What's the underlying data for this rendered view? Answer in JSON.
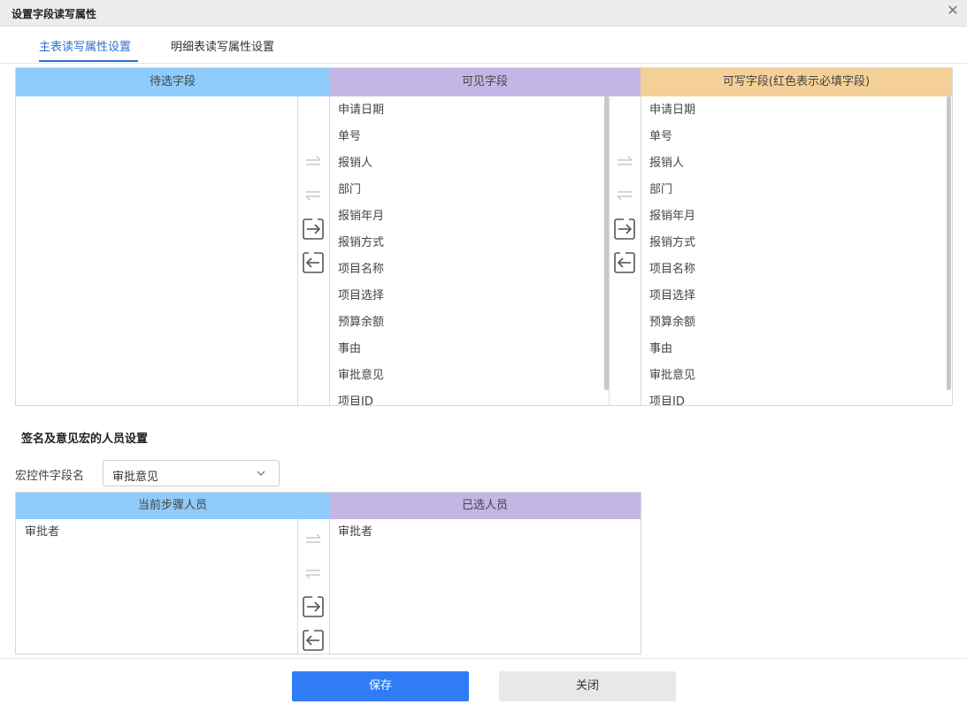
{
  "dialog": {
    "title": "设置字段读写属性",
    "close_icon": "close-icon"
  },
  "tabs": [
    {
      "label": "主表读写属性设置",
      "active": true
    },
    {
      "label": "明细表读写属性设置",
      "active": false
    }
  ],
  "fields": {
    "candidate_header": "待选字段",
    "visible_header": "可见字段",
    "writable_header": "可写字段(红色表示必填字段)",
    "candidate_items": [],
    "visible_items": [
      "申请日期",
      "单号",
      "报销人",
      "部门",
      "报销年月",
      "报销方式",
      "项目名称",
      "项目选择",
      "预算余额",
      "事由",
      "审批意见",
      "项目ID"
    ],
    "writable_items": [
      "申请日期",
      "单号",
      "报销人",
      "部门",
      "报销年月",
      "报销方式",
      "项目名称",
      "项目选择",
      "预算余额",
      "事由",
      "审批意见",
      "项目ID"
    ]
  },
  "signature": {
    "section_title": "签名及意见宏的人员设置",
    "macro_label": "宏控件字段名",
    "macro_value": "审批意见",
    "current_header": "当前步骤人员",
    "selected_header": "已选人员",
    "current_items": [
      "审批者"
    ],
    "selected_items": [
      "审批者"
    ]
  },
  "footer": {
    "save_label": "保存",
    "close_label": "关闭"
  },
  "colors": {
    "accent": "#2d6fd6",
    "primary_button": "#2f7cf6",
    "header_blue": "#8fcbfb",
    "header_purple": "#c3b5e6",
    "header_orange": "#f4cf97"
  },
  "icons": [
    "move-all-right-icon",
    "move-all-left-icon",
    "move-right-icon",
    "move-left-icon",
    "chevron-down-icon"
  ]
}
